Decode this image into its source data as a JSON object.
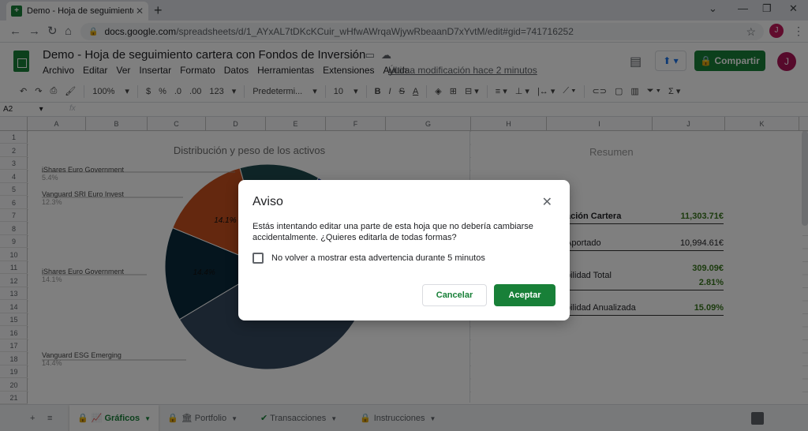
{
  "browser": {
    "tab_title": "Demo - Hoja de seguimiento car",
    "url_host": "docs.google.com",
    "url_path": "/spreadsheets/d/1_AYxAL7tDKcKCuir_wHfwAWrqaWjywRbeaanD7xYvtM/edit#gid=741716252",
    "profile_initial": "J"
  },
  "sheets": {
    "doc_title": "Demo - Hoja de seguimiento cartera con Fondos de Inversión",
    "menu": [
      "Archivo",
      "Editar",
      "Ver",
      "Insertar",
      "Formato",
      "Datos",
      "Herramientas",
      "Extensiones",
      "Ayuda"
    ],
    "last_edit": "Última modificación hace 2 minutos",
    "share_label": "Compartir",
    "profile_initial": "J"
  },
  "toolbar": {
    "zoom": "100%",
    "currency": "$",
    "percent": "%",
    "dec_less": ".0",
    "dec_more": ".00",
    "format_more": "123",
    "font": "Predetermi...",
    "font_size": "10"
  },
  "formula_bar": {
    "name_box": "A2",
    "fx": "fx"
  },
  "grid": {
    "columns": [
      "A",
      "B",
      "C",
      "D",
      "E",
      "F",
      "G",
      "H",
      "I",
      "J",
      "K"
    ],
    "rows": [
      "1",
      "2",
      "3",
      "4",
      "5",
      "6",
      "7",
      "8",
      "9",
      "10",
      "11",
      "12",
      "13",
      "14",
      "15",
      "16",
      "17",
      "18",
      "19",
      "20",
      "21"
    ]
  },
  "chart_data": {
    "type": "pie",
    "title": "Distribución y peso de los activos",
    "slices": [
      {
        "label": "iShares Euro Government",
        "pct_label": "5.4%",
        "value": 5.4,
        "color": "#1f3a93"
      },
      {
        "label": "",
        "pct_label": "",
        "value": 11.0,
        "color": "#2c4a63"
      },
      {
        "label": "",
        "pct_label": "",
        "value": 40.3,
        "color": "#34495e"
      },
      {
        "label": "Vanguard ESG Emerging",
        "pct_label": "14.4%",
        "value": 14.4,
        "color": "#0b2a3c"
      },
      {
        "label": "iShares Euro Government",
        "pct_label": "14.1%",
        "value": 14.1,
        "color": "#c8501e"
      },
      {
        "label": "Vanguard SRI Euro Invest",
        "pct_label": "12.3%",
        "value": 12.3,
        "color": "#1f4a4f"
      }
    ]
  },
  "summary": {
    "title": "Resumen",
    "rows": [
      {
        "label": "ación Cartera",
        "values": [
          "11,303.71€"
        ],
        "bold": true
      },
      {
        "label": "Aportado",
        "values": [
          "10,994.61€"
        ],
        "bold": false
      },
      {
        "label": "bilidad Total",
        "values": [
          "309.09€",
          "2.81%"
        ],
        "bold": true
      },
      {
        "label": "bilidad Anualizada",
        "values": [
          "15.09%"
        ],
        "bold": true
      }
    ],
    "positive_color": "#38761d"
  },
  "sheet_tabs": [
    {
      "label": "Gráficos",
      "active": true
    },
    {
      "label": "Portfolio",
      "active": false
    },
    {
      "label": "Transacciones",
      "active": false
    },
    {
      "label": "Instrucciones",
      "active": false
    }
  ],
  "dialog": {
    "title": "Aviso",
    "message": "Estás intentando editar una parte de esta hoja que no debería cambiarse accidentalmente. ¿Quieres editarla de todas formas?",
    "checkbox_label": "No volver a mostrar esta advertencia durante 5 minutos",
    "cancel_label": "Cancelar",
    "ok_label": "Aceptar"
  }
}
